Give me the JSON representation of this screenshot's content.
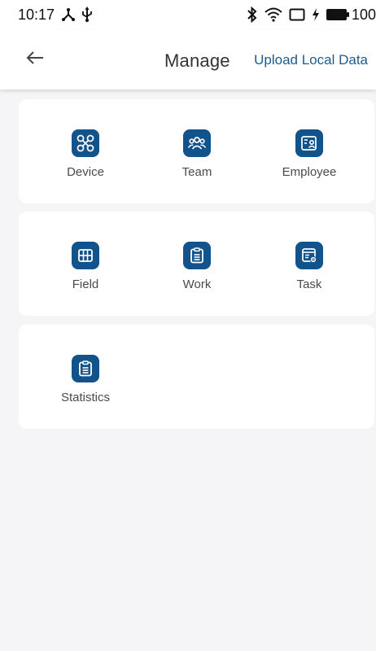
{
  "status_bar": {
    "time": "10:17",
    "battery": "100",
    "icons": [
      "network-share-icon",
      "usb-icon",
      "bluetooth-icon",
      "wifi-icon",
      "cast-icon",
      "charging-icon",
      "battery-icon"
    ]
  },
  "header": {
    "title": "Manage",
    "action": "Upload Local Data",
    "back_icon": "back-arrow-icon"
  },
  "colors": {
    "accent": "#13538c",
    "link": "#1f5b8c",
    "background": "#f5f5f7",
    "card": "#ffffff"
  },
  "sections": [
    {
      "items": [
        {
          "label": "Device",
          "icon": "drone-icon"
        },
        {
          "label": "Team",
          "icon": "group-icon"
        },
        {
          "label": "Employee",
          "icon": "id-card-icon"
        }
      ]
    },
    {
      "items": [
        {
          "label": "Field",
          "icon": "grid-map-icon"
        },
        {
          "label": "Work",
          "icon": "clipboard-icon"
        },
        {
          "label": "Task",
          "icon": "task-settings-icon"
        }
      ]
    },
    {
      "items": [
        {
          "label": "Statistics",
          "icon": "clipboard-icon"
        }
      ]
    }
  ]
}
